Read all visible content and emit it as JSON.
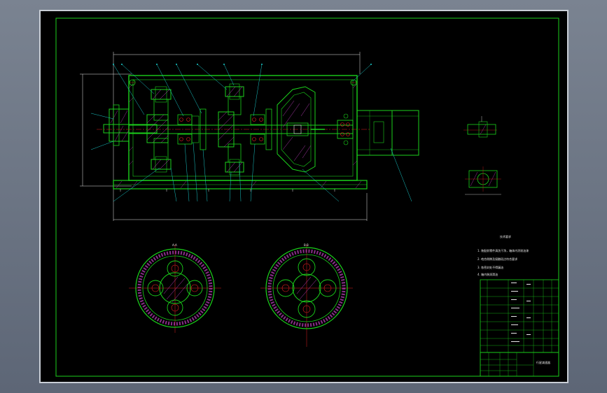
{
  "colors": {
    "background": "#000000",
    "outline": "#1bd11b",
    "dimension": "#e6e6e6",
    "centerline": "#e02020",
    "hatch": "#c040c0",
    "leader": "#19c8c8"
  },
  "drawing": {
    "section_labels": [
      "A-A",
      "B-B"
    ],
    "tech_requirements_title": "技术要求",
    "tech_requirements": [
      "1. 装配前零件清洗干净，箱体内涂耐油漆",
      "2. 啮合侧隙及接触斑点符合要求",
      "3. 各密封处不得漏油",
      "4. 箱内装润滑油"
    ],
    "title_block_name": "行星减速器"
  }
}
